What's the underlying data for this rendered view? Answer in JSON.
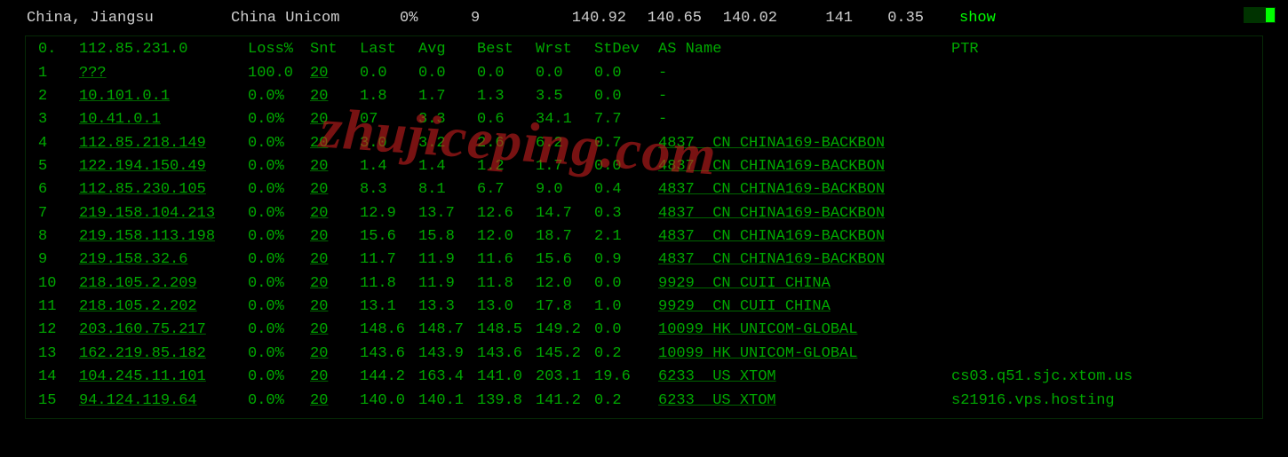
{
  "topbar": {
    "location": "China, Jiangsu",
    "isp": "China Unicom",
    "loss": "0%",
    "sent": "9",
    "ms1": "140.92",
    "ms2": "140.65",
    "ms3": "140.02",
    "ms4": "141",
    "jitter": "0.35",
    "show": "show"
  },
  "headers": {
    "idx": "0.",
    "host": "112.85.231.0",
    "loss": "Loss%",
    "snt": "Snt",
    "last": "Last",
    "avg": "Avg",
    "best": "Best",
    "wrst": "Wrst",
    "stdev": "StDev",
    "asname": "AS Name",
    "ptr": "PTR"
  },
  "hops": [
    {
      "n": "1",
      "host": "???",
      "loss": "100.0",
      "snt": "20",
      "last": "0.0",
      "avg": "0.0",
      "best": "0.0",
      "wrst": "0.0",
      "std": "0.0",
      "as": "-",
      "ptr": ""
    },
    {
      "n": "2",
      "host": "10.101.0.1",
      "loss": "0.0%",
      "snt": "20",
      "last": "1.8",
      "avg": "1.7",
      "best": "1.3",
      "wrst": "3.5",
      "std": "0.0",
      "as": "-",
      "ptr": ""
    },
    {
      "n": "3",
      "host": "10.41.0.1",
      "loss": "0.0%",
      "snt": "20",
      "last": "07",
      "avg": "3.3",
      "best": "0.6",
      "wrst": "34.1",
      "std": "7.7",
      "as": "-",
      "ptr": ""
    },
    {
      "n": "4",
      "host": "112.85.218.149",
      "loss": "0.0%",
      "snt": "20",
      "last": "3.0",
      "avg": "3.2",
      "best": "2.6",
      "wrst": "6.2",
      "std": "0.7",
      "as": "4837  CN CHINA169-BACKBON",
      "ptr": ""
    },
    {
      "n": "5",
      "host": "122.194.150.49",
      "loss": "0.0%",
      "snt": "20",
      "last": "1.4",
      "avg": "1.4",
      "best": "1.2",
      "wrst": "1.7",
      "std": "0.0",
      "as": "4837  CN CHINA169-BACKBON",
      "ptr": ""
    },
    {
      "n": "6",
      "host": "112.85.230.105",
      "loss": "0.0%",
      "snt": "20",
      "last": "8.3",
      "avg": "8.1",
      "best": "6.7",
      "wrst": "9.0",
      "std": "0.4",
      "as": "4837  CN CHINA169-BACKBON",
      "ptr": ""
    },
    {
      "n": "7",
      "host": "219.158.104.213",
      "loss": "0.0%",
      "snt": "20",
      "last": "12.9",
      "avg": "13.7",
      "best": "12.6",
      "wrst": "14.7",
      "std": "0.3",
      "as": "4837  CN CHINA169-BACKBON",
      "ptr": ""
    },
    {
      "n": "8",
      "host": "219.158.113.198",
      "loss": "0.0%",
      "snt": "20",
      "last": "15.6",
      "avg": "15.8",
      "best": "12.0",
      "wrst": "18.7",
      "std": "2.1",
      "as": "4837  CN CHINA169-BACKBON",
      "ptr": ""
    },
    {
      "n": "9",
      "host": "219.158.32.6",
      "loss": "0.0%",
      "snt": "20",
      "last": "11.7",
      "avg": "11.9",
      "best": "11.6",
      "wrst": "15.6",
      "std": "0.9",
      "as": "4837  CN CHINA169-BACKBON",
      "ptr": ""
    },
    {
      "n": "10",
      "host": "218.105.2.209",
      "loss": "0.0%",
      "snt": "20",
      "last": "11.8",
      "avg": "11.9",
      "best": "11.8",
      "wrst": "12.0",
      "std": "0.0",
      "as": "9929  CN CUII CHINA",
      "ptr": ""
    },
    {
      "n": "11",
      "host": "218.105.2.202",
      "loss": "0.0%",
      "snt": "20",
      "last": "13.1",
      "avg": "13.3",
      "best": "13.0",
      "wrst": "17.8",
      "std": "1.0",
      "as": "9929  CN CUII CHINA",
      "ptr": ""
    },
    {
      "n": "12",
      "host": "203.160.75.217",
      "loss": "0.0%",
      "snt": "20",
      "last": "148.6",
      "avg": "148.7",
      "best": "148.5",
      "wrst": "149.2",
      "std": "0.0",
      "as": "10099 HK UNICOM-GLOBAL",
      "ptr": ""
    },
    {
      "n": "13",
      "host": "162.219.85.182",
      "loss": "0.0%",
      "snt": "20",
      "last": "143.6",
      "avg": "143.9",
      "best": "143.6",
      "wrst": "145.2",
      "std": "0.2",
      "as": "10099 HK UNICOM-GLOBAL",
      "ptr": ""
    },
    {
      "n": "14",
      "host": "104.245.11.101",
      "loss": "0.0%",
      "snt": "20",
      "last": "144.2",
      "avg": "163.4",
      "best": "141.0",
      "wrst": "203.1",
      "std": "19.6",
      "as": "6233  US XTOM",
      "ptr": "cs03.q51.sjc.xtom.us"
    },
    {
      "n": "15",
      "host": "94.124.119.64",
      "loss": "0.0%",
      "snt": "20",
      "last": "140.0",
      "avg": "140.1",
      "best": "139.8",
      "wrst": "141.2",
      "std": "0.2",
      "as": "6233  US XTOM",
      "ptr": "s21916.vps.hosting"
    }
  ],
  "watermark": "zhujiceping.com"
}
